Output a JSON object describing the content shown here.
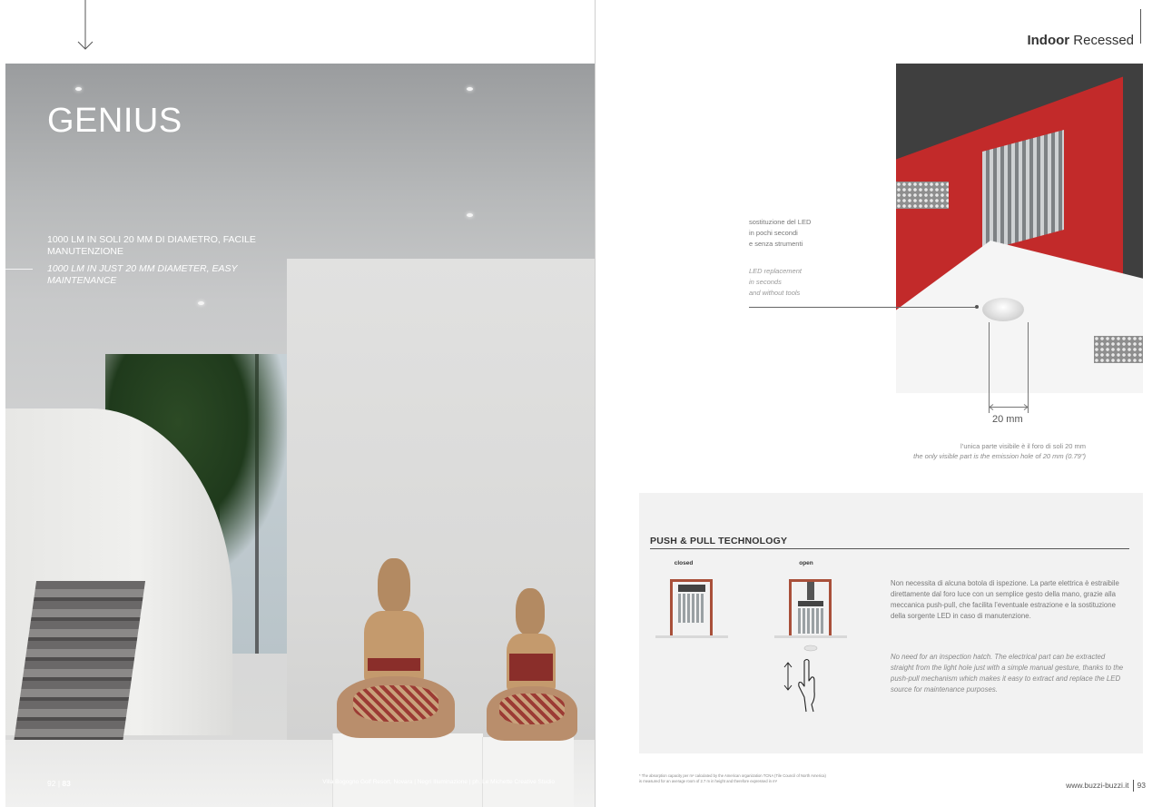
{
  "left_page": {
    "title": "GENIUS",
    "subtitle_it": "1000 lm IN SOLI 20 mm DI DIAMETRO, FACILE MANUTENZIONE",
    "subtitle_en": "1000 lm IN JUST 20 mm DIAMETER, EASY MAINTENANCE",
    "folio_number": "92",
    "folio_section": "83",
    "photo_credit": "Villa Bogogno Golf Resort, Novara | Negri Illuminazione | ph. Le Michette Creative Studio"
  },
  "right_page": {
    "header_bold": "Indoor",
    "header_regular": "Recessed",
    "callout_it": [
      "sostituzione del LED",
      "in pochi secondi",
      "e senza strumenti"
    ],
    "callout_en": [
      "LED replacement",
      "in seconds",
      "and without tools"
    ],
    "dimension_label": "20 mm",
    "caption_it": "l’unica parte visibile è il foro di soli 20 mm",
    "caption_en": "the only visible part is the emission hole of 20 mm (0.79\")",
    "tech": {
      "title": "PUSH & PULL TECHNOLOGY",
      "label_closed": "closed",
      "label_open": "open",
      "text_it": "Non necessita di alcuna botola di ispezione. La parte elettrica è estraibile direttamente dal foro luce con un semplice gesto della mano, grazie alla meccanica push-pull, che facilita l’eventuale estrazione e la sostituzione della sorgente LED in caso di manutenzione.",
      "text_en": "No need for an inspection hatch. The electrical part can be extracted straight from the light hole just with a simple manual gesture, thanks to the push-pull mechanism which makes it easy to extract and replace the LED source for maintenance purposes."
    },
    "footnote": "* The absorption capacity per m² calculated by the American organization TCNA (Tile Council of North America) is measured for an average room of 2.7 m in height and therefore expressed in m²",
    "website": "www.buzzi-buzzi.it",
    "folio_number": "93"
  },
  "colors": {
    "accent_red": "#c22a2a",
    "panel_gray": "#f2f2f2",
    "text_gray": "#777777"
  }
}
